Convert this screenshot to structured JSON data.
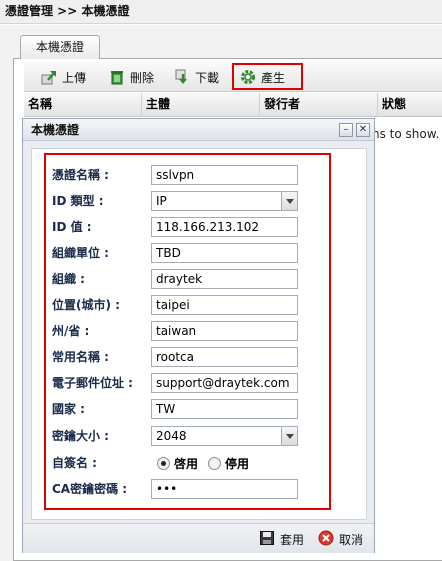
{
  "breadcrumb": "憑證管理 >> 本機憑證",
  "tab": {
    "label": "本機憑證"
  },
  "toolbar": {
    "upload_label": "上傳",
    "delete_label": "刪除",
    "download_label": "下載",
    "generate_label": "產生"
  },
  "table": {
    "columns": [
      "名稱",
      "主體",
      "發行者",
      "狀態"
    ],
    "empty_message": "ns to show."
  },
  "dialog": {
    "title": "本機憑證",
    "fields": [
      {
        "label": "憑證名稱 :",
        "value": "sslvpn"
      },
      {
        "label": "ID 類型 :",
        "value": "IP"
      },
      {
        "label": "ID 值 :",
        "value": "118.166.213.102"
      },
      {
        "label": "組織單位 :",
        "value": "TBD"
      },
      {
        "label": "組織 :",
        "value": "draytek"
      },
      {
        "label": "位置(城市) :",
        "value": "taipei"
      },
      {
        "label": "州/省 :",
        "value": "taiwan"
      },
      {
        "label": "常用名稱 :",
        "value": "rootca"
      },
      {
        "label": "電子郵件位址 :",
        "value": "support@draytek.com"
      },
      {
        "label": "國家 :",
        "value": "TW"
      },
      {
        "label": "密鑰大小 :",
        "value": "2048"
      },
      {
        "label": "自簽名 :",
        "value": ""
      },
      {
        "label": "CA密鑰密碼 :",
        "value": "•••"
      }
    ],
    "self_signed": {
      "enable_label": "啓用",
      "disable_label": "停用",
      "selected": "enable"
    },
    "apply_label": "套用",
    "cancel_label": "取消"
  },
  "colors": {
    "highlight": "#e00000",
    "label_text": "#1a2a4a"
  }
}
